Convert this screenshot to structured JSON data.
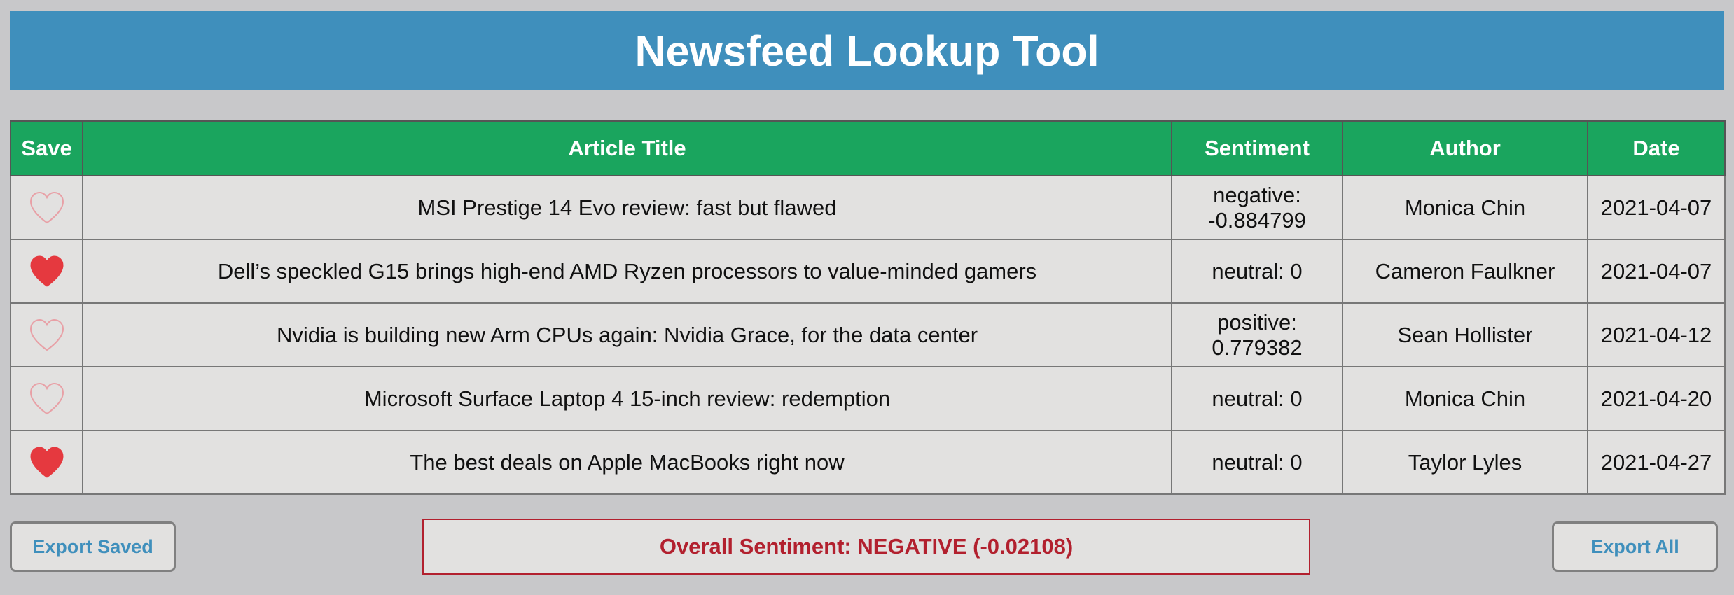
{
  "header": {
    "title": "Newsfeed Lookup Tool"
  },
  "table": {
    "columns": [
      "Save",
      "Article Title",
      "Sentiment",
      "Author",
      "Date"
    ],
    "rows": [
      {
        "saved": false,
        "title": "MSI Prestige 14 Evo review: fast but flawed",
        "sentiment_line1": "negative:",
        "sentiment_line2": "-0.884799",
        "author": "Monica Chin",
        "date": "2021-04-07"
      },
      {
        "saved": true,
        "title": "Dell’s speckled G15 brings high-end AMD Ryzen processors to value-minded gamers",
        "sentiment_line1": "neutral: 0",
        "sentiment_line2": "",
        "author": "Cameron Faulkner",
        "date": "2021-04-07"
      },
      {
        "saved": false,
        "title": "Nvidia is building new Arm CPUs again: Nvidia Grace, for the data center",
        "sentiment_line1": "positive:",
        "sentiment_line2": "0.779382",
        "author": "Sean Hollister",
        "date": "2021-04-12"
      },
      {
        "saved": false,
        "title": "Microsoft Surface Laptop 4 15-inch review: redemption",
        "sentiment_line1": "neutral: 0",
        "sentiment_line2": "",
        "author": "Monica Chin",
        "date": "2021-04-20"
      },
      {
        "saved": true,
        "title": "The best deals on Apple MacBooks right now",
        "sentiment_line1": "neutral: 0",
        "sentiment_line2": "",
        "author": "Taylor Lyles",
        "date": "2021-04-27"
      }
    ]
  },
  "footer": {
    "export_saved_label": "Export Saved",
    "export_all_label": "Export All",
    "overall_sentiment": "Overall Sentiment: NEGATIVE (-0.02108)"
  },
  "colors": {
    "header_bg": "#3f8fbc",
    "table_header_bg": "#1aa55e",
    "heart_filled": "#e5393f",
    "heart_outline": "#e8a0a6",
    "overall_text": "#b2202e",
    "button_text": "#3f8fbc"
  },
  "icons": {
    "saved": "heart-filled-icon",
    "unsaved": "heart-outline-icon"
  }
}
